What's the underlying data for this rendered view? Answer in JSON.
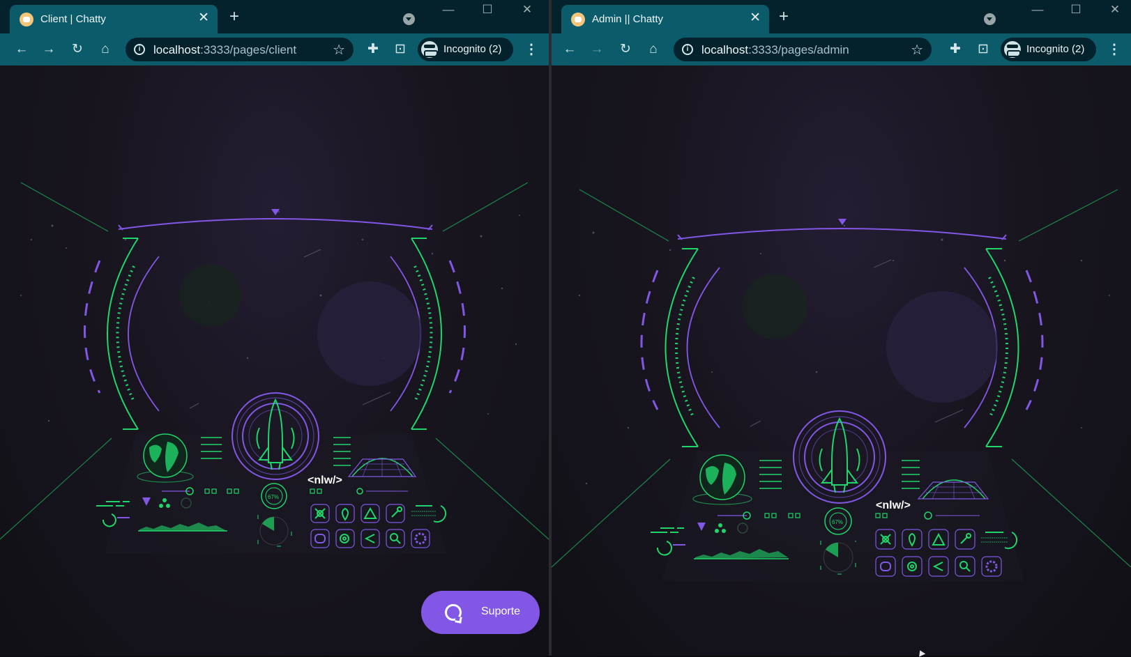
{
  "client_window": {
    "tab": {
      "title": "Client | Chatty",
      "close": "✕"
    },
    "new_tab": "+",
    "window_controls": {
      "minimize": "—",
      "maximize": "☐",
      "close": "✕"
    },
    "toolbar": {
      "back": "←",
      "forward": "→",
      "reload": "↻",
      "home": "⌂",
      "url_host": "localhost",
      "url_rest": ":3333/pages/client",
      "bookmark": "☆",
      "incognito_label": "Incognito (2)",
      "menu": "⋮"
    },
    "page": {
      "hud_brand": "<nlw/>",
      "hud_percent": "67%",
      "support_button_label": "Suporte"
    }
  },
  "admin_window": {
    "tab": {
      "title": "Admin || Chatty",
      "close": "✕"
    },
    "new_tab": "+",
    "window_controls": {
      "minimize": "—",
      "maximize": "☐",
      "close": "✕"
    },
    "toolbar": {
      "back": "←",
      "forward": "→",
      "reload": "↻",
      "home": "⌂",
      "url_host": "localhost",
      "url_rest": ":3333/pages/admin",
      "bookmark": "☆",
      "incognito_label": "Incognito (2)",
      "menu": "⋮"
    },
    "page": {
      "hud_brand": "<nlw/>",
      "hud_percent": "67%"
    }
  },
  "colors": {
    "browser_frame": "#0b5b6b",
    "tab_strip": "#04222c",
    "hud_green": "#1fd66b",
    "hud_purple": "#8257e5",
    "support_button": "#8257e5"
  }
}
